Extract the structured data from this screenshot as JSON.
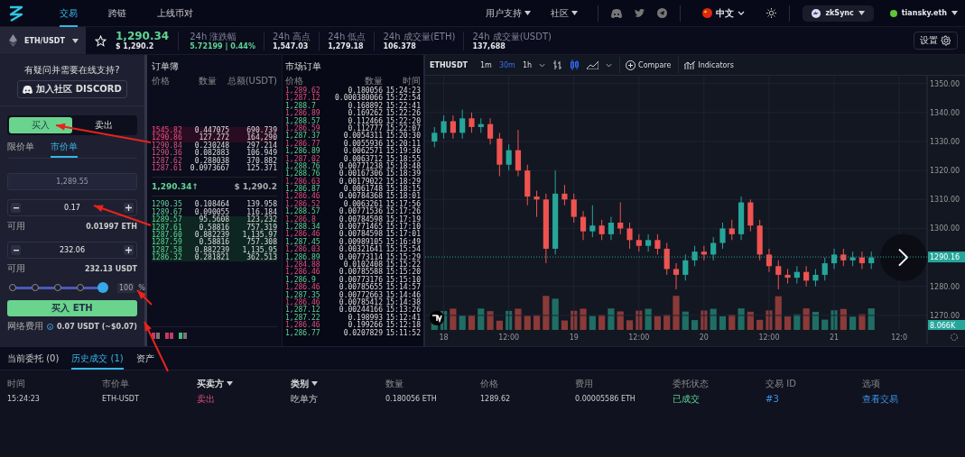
{
  "nav": {
    "tabs": [
      {
        "label": "交易",
        "selected": true
      },
      {
        "label": "跨链",
        "selected": false
      },
      {
        "label": "上线币对",
        "selected": false
      }
    ],
    "menus": [
      {
        "label": "用户支持"
      },
      {
        "label": "社区"
      }
    ],
    "language": "中文",
    "network": "zkSync",
    "account": "tiansky.eth"
  },
  "ticker": {
    "pair": "ETH/USDT",
    "price": "1,290.34",
    "price_usd": "$ 1,290.2",
    "stats": [
      {
        "label": "24h 涨跌幅",
        "value": "5.72199 | 0.44%",
        "kind": "change"
      },
      {
        "label": "24h 高点",
        "value": "1,547.03",
        "kind": "plain"
      },
      {
        "label": "24h 低点",
        "value": "1,279.18",
        "kind": "plain"
      },
      {
        "label": "24h 成交量(ETH)",
        "value": "106.378",
        "kind": "plain"
      },
      {
        "label": "24h 成交量(USDT)",
        "value": "137,688",
        "kind": "plain"
      }
    ],
    "settings": "设置"
  },
  "trade_panel": {
    "support_text": "有疑问并需要在线支持?",
    "discord_button": "加入社区 DISCORD",
    "sides": [
      {
        "label": "买入",
        "selected": true
      },
      {
        "label": "卖出",
        "selected": false
      }
    ],
    "order_types": [
      {
        "label": "限价单",
        "selected": false
      },
      {
        "label": "市价单",
        "selected": true
      }
    ],
    "price_field": {
      "value": "1,289.55",
      "disabled": true
    },
    "amount_field": {
      "value": "0.17"
    },
    "available_1": {
      "label": "可用",
      "value": "0.01997 ETH"
    },
    "total_field": {
      "value": "232.06"
    },
    "available_2": {
      "label": "可用",
      "value": "232.13 USDT"
    },
    "slider": {
      "level": 1,
      "percent": "100",
      "unit": "%"
    },
    "submit": "买入 ETH",
    "fee": {
      "label": "网络费用",
      "value": "0.07 USDT (~$0.07)"
    }
  },
  "order_book": {
    "title": "订单簿",
    "columns": [
      "价格",
      "数量",
      "总额(USDT)"
    ],
    "asks": [
      {
        "price": "1545.82",
        "amount": "0.447075",
        "total": "690.739",
        "highlighted": true
      },
      {
        "price": "1290.86",
        "amount": "127.272",
        "total": "164,290",
        "highlighted": true
      },
      {
        "price": "1290.84",
        "amount": "0.230248",
        "total": "297.214",
        "highlighted": false
      },
      {
        "price": "1290.36",
        "amount": "0.082883",
        "total": "106.949",
        "highlighted": false
      },
      {
        "price": "1287.62",
        "amount": "0.288038",
        "total": "370.882",
        "highlighted": false
      },
      {
        "price": "1287.61",
        "amount": "0.0973667",
        "total": "125.371",
        "highlighted": false
      }
    ],
    "last_price": "1,290.34↑",
    "last_price_usd": "$ 1,290.2",
    "bids": [
      {
        "price": "1290.35",
        "amount": "0.108464",
        "total": "139.958",
        "highlighted": false
      },
      {
        "price": "1289.67",
        "amount": "0.090055",
        "total": "116.184",
        "highlighted": false
      },
      {
        "price": "1289.57",
        "amount": "95.5608",
        "total": "123,232",
        "highlighted": true
      },
      {
        "price": "1287.61",
        "amount": "0.58816",
        "total": "757.319",
        "highlighted": true
      },
      {
        "price": "1287.60",
        "amount": "0.882239",
        "total": "1,135.97",
        "highlighted": true
      },
      {
        "price": "1287.59",
        "amount": "0.58816",
        "total": "757.308",
        "highlighted": true
      },
      {
        "price": "1287.58",
        "amount": "0.882239",
        "total": "1,135.95",
        "highlighted": true
      },
      {
        "price": "1286.32",
        "amount": "0.281821",
        "total": "362.513",
        "highlighted": true
      }
    ]
  },
  "market_trades": {
    "title": "市场订单",
    "columns": [
      "价格",
      "数量",
      "时间"
    ],
    "rows": [
      {
        "price": "1,289.62",
        "amount": "0.180056",
        "time": "15:24:23",
        "kind": "sell"
      },
      {
        "price": "1,287.12",
        "amount": "0.000380066",
        "time": "15:22:54",
        "kind": "sell"
      },
      {
        "price": "1,288.7",
        "amount": "0.168892",
        "time": "15:22:41",
        "kind": "buy"
      },
      {
        "price": "1,286.89",
        "amount": "0.169262",
        "time": "15:22:26",
        "kind": "sell"
      },
      {
        "price": "1,288.57",
        "amount": "0.112466",
        "time": "15:22:20",
        "kind": "buy"
      },
      {
        "price": "1,286.59",
        "amount": "0.112777",
        "time": "15:22:07",
        "kind": "sell"
      },
      {
        "price": "1,287.37",
        "amount": "0.0054311",
        "time": "15:20:30",
        "kind": "buy"
      },
      {
        "price": "1,286.77",
        "amount": "0.0055936",
        "time": "15:20:11",
        "kind": "sell"
      },
      {
        "price": "1,286.89",
        "amount": "0.0062571",
        "time": "15:19:36",
        "kind": "buy"
      },
      {
        "price": "1,287.02",
        "amount": "0.0063712",
        "time": "15:18:55",
        "kind": "sell"
      },
      {
        "price": "1,288.76",
        "amount": "0.00771238",
        "time": "15:18:48",
        "kind": "buy"
      },
      {
        "price": "1,288.76",
        "amount": "0.00167306",
        "time": "15:18:39",
        "kind": "buy"
      },
      {
        "price": "1,286.63",
        "amount": "0.00179022",
        "time": "15:18:29",
        "kind": "sell"
      },
      {
        "price": "1,286.87",
        "amount": "0.0061748",
        "time": "15:18:15",
        "kind": "buy"
      },
      {
        "price": "1,286.46",
        "amount": "0.00784368",
        "time": "15:18:01",
        "kind": "sell"
      },
      {
        "price": "1,286.52",
        "amount": "0.0063261",
        "time": "15:17:56",
        "kind": "sell"
      },
      {
        "price": "1,288.57",
        "amount": "0.00771536",
        "time": "15:17:26",
        "kind": "buy"
      },
      {
        "price": "1,286.8",
        "amount": "0.00784598",
        "time": "15:17:19",
        "kind": "sell"
      },
      {
        "price": "1,288.34",
        "amount": "0.00771465",
        "time": "15:17:10",
        "kind": "buy"
      },
      {
        "price": "1,286.46",
        "amount": "0.00784598",
        "time": "15:17:01",
        "kind": "sell"
      },
      {
        "price": "1,287.45",
        "amount": "0.00989105",
        "time": "15:16:49",
        "kind": "buy"
      },
      {
        "price": "1,286.03",
        "amount": "0.00321641",
        "time": "15:15:54",
        "kind": "sell"
      },
      {
        "price": "1,286.89",
        "amount": "0.00773114",
        "time": "15:15:29",
        "kind": "buy"
      },
      {
        "price": "1,284.88",
        "amount": "0.0102408",
        "time": "15:15:22",
        "kind": "sell"
      },
      {
        "price": "1,286.46",
        "amount": "0.00785588",
        "time": "15:15:20",
        "kind": "sell"
      },
      {
        "price": "1,286.9",
        "amount": "0.00773176",
        "time": "15:15:10",
        "kind": "buy"
      },
      {
        "price": "1,286.46",
        "amount": "0.00785655",
        "time": "15:14:57",
        "kind": "sell"
      },
      {
        "price": "1,287.35",
        "amount": "0.00772663",
        "time": "15:14:46",
        "kind": "buy"
      },
      {
        "price": "1,286.46",
        "amount": "0.00785412",
        "time": "15:14:38",
        "kind": "sell"
      },
      {
        "price": "1,287.12",
        "amount": "0.00244166",
        "time": "15:13:26",
        "kind": "buy"
      },
      {
        "price": "1,287.22",
        "amount": "0.198993",
        "time": "15:12:41",
        "kind": "buy"
      },
      {
        "price": "1,286.46",
        "amount": "0.199266",
        "time": "15:12:18",
        "kind": "sell"
      },
      {
        "price": "1,286.77",
        "amount": "0.0207829",
        "time": "15:11:52",
        "kind": "buy"
      }
    ]
  },
  "chart": {
    "symbol": "ETHUSDT",
    "intervals": [
      {
        "label": "1m",
        "selected": false
      },
      {
        "label": "30m",
        "selected": true
      },
      {
        "label": "1h",
        "selected": false
      }
    ],
    "compare": "Compare",
    "indicators": "Indicators",
    "price_tag": "1290.16",
    "volume_tag": "8.066K",
    "chart_data": {
      "type": "candlestick",
      "ylim": [
        1265,
        1352.7
      ],
      "grid": true,
      "categories": [
        null,
        "18",
        null,
        null,
        null,
        null,
        null,
        null,
        "12:00",
        null,
        null,
        null,
        null,
        null,
        null,
        "19",
        null,
        null,
        null,
        null,
        null,
        null,
        "12:00",
        null,
        null,
        null,
        null,
        null,
        null,
        "20",
        null,
        null,
        null,
        null,
        null,
        null,
        "12:00",
        null,
        null,
        null,
        null,
        null,
        null,
        "21",
        null,
        null,
        null,
        null,
        null,
        null,
        "12:0",
        null
      ],
      "ohlc": [
        [
          1330,
          1335,
          1328,
          1333
        ],
        [
          1333,
          1339,
          1331,
          1337
        ],
        [
          1337,
          1339,
          1331,
          1333
        ],
        [
          1333,
          1341,
          1331,
          1338
        ],
        [
          1338,
          1340,
          1333,
          1335
        ],
        [
          1335,
          1338,
          1333,
          1336
        ],
        [
          1336,
          1338,
          1329,
          1331
        ],
        [
          1331,
          1333,
          1318,
          1322
        ],
        [
          1322,
          1329,
          1320,
          1327
        ],
        [
          1327,
          1334,
          1318,
          1320
        ],
        [
          1320,
          1322,
          1308,
          1311
        ],
        [
          1311,
          1313,
          1304,
          1310
        ],
        [
          1310,
          1312,
          1288,
          1293
        ],
        [
          1293,
          1320,
          1291,
          1312
        ],
        [
          1312,
          1315,
          1308,
          1310
        ],
        [
          1310,
          1312,
          1302,
          1304
        ],
        [
          1304,
          1306,
          1296,
          1299
        ],
        [
          1299,
          1308,
          1297,
          1301
        ],
        [
          1301,
          1303,
          1296,
          1298
        ],
        [
          1298,
          1304,
          1296,
          1302
        ],
        [
          1302,
          1309,
          1298,
          1300
        ],
        [
          1300,
          1302,
          1293,
          1296
        ],
        [
          1296,
          1298,
          1292,
          1294
        ],
        [
          1294,
          1298,
          1292,
          1296
        ],
        [
          1296,
          1298,
          1291,
          1293
        ],
        [
          1293,
          1295,
          1284,
          1286
        ],
        [
          1286,
          1288,
          1279,
          1284
        ],
        [
          1284,
          1291,
          1282,
          1289
        ],
        [
          1289,
          1294,
          1287,
          1292
        ],
        [
          1292,
          1294,
          1289,
          1291
        ],
        [
          1291,
          1297,
          1289,
          1295
        ],
        [
          1295,
          1302,
          1293,
          1300
        ],
        [
          1300,
          1303,
          1296,
          1298
        ],
        [
          1298,
          1311,
          1296,
          1309
        ],
        [
          1309,
          1310,
          1299,
          1301
        ],
        [
          1301,
          1303,
          1289,
          1291
        ],
        [
          1291,
          1293,
          1285,
          1287
        ],
        [
          1287,
          1289,
          1279,
          1284
        ],
        [
          1284,
          1286,
          1281,
          1283
        ],
        [
          1283,
          1287,
          1281,
          1285
        ],
        [
          1285,
          1287,
          1280,
          1282
        ],
        [
          1282,
          1286,
          1280,
          1284
        ],
        [
          1284,
          1290,
          1282,
          1288
        ],
        [
          1288,
          1293,
          1286,
          1291
        ],
        [
          1291,
          1293,
          1287,
          1289
        ],
        [
          1289,
          1292,
          1287,
          1290
        ],
        [
          1290,
          1292,
          1286,
          1288
        ],
        [
          1288,
          1292,
          1286,
          1290
        ],
        null,
        null,
        null,
        null
      ],
      "yticks": [
        {
          "value": 1350,
          "label": "1350.00"
        },
        {
          "value": 1340,
          "label": "1340.00"
        },
        {
          "value": 1330,
          "label": "1330.00"
        },
        {
          "value": 1320,
          "label": "1320.00"
        },
        {
          "value": 1310,
          "label": "1310.00"
        },
        {
          "value": 1300,
          "label": "1300.00"
        },
        {
          "value": 1280,
          "label": "1280.00"
        },
        {
          "value": 1270,
          "label": "1270.00"
        }
      ]
    }
  },
  "bottom": {
    "tabs": [
      {
        "label": "当前委托",
        "count": "(0)",
        "selected": false
      },
      {
        "label": "历史成交",
        "count": "(1)",
        "selected": true
      },
      {
        "label": "资产",
        "selected": false
      }
    ],
    "columns": [
      {
        "label": "时间",
        "sortable": false
      },
      {
        "label": "市价单",
        "sortable": false
      },
      {
        "label": "买卖方",
        "sortable": true
      },
      {
        "label": "类别",
        "sortable": true
      },
      {
        "label": "数量",
        "sortable": false
      },
      {
        "label": "价格",
        "sortable": false
      },
      {
        "label": "费用",
        "sortable": false
      },
      {
        "label": "委托状态",
        "sortable": false
      },
      {
        "label": "交易 ID",
        "sortable": false
      },
      {
        "label": "选项",
        "sortable": false
      }
    ],
    "rows": [
      {
        "time": "15:24:23",
        "market": "ETH-USDT",
        "side": "卖出",
        "kind": "sell",
        "type": "吃单方",
        "amount": "0.180056 ETH",
        "price": "1289.62",
        "fee": "0.00005586 ETH",
        "status": "已成交",
        "trade_id": "#3",
        "action": "查看交易"
      }
    ]
  }
}
